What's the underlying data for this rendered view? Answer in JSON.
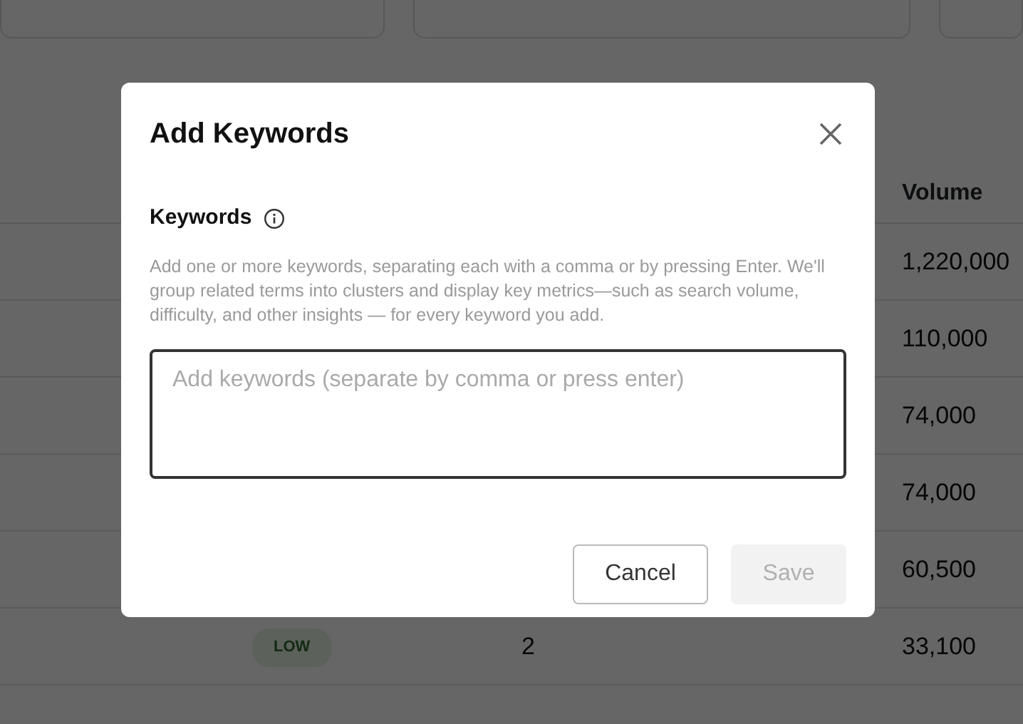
{
  "table": {
    "columns": [
      "Volume"
    ],
    "rows": [
      {
        "volume": "1,220,000"
      },
      {
        "volume": "110,000"
      },
      {
        "volume": "74,000"
      },
      {
        "volume": "74,000"
      },
      {
        "volume": "60,500"
      },
      {
        "tag": "LOW",
        "column_3": "2",
        "volume": "33,100"
      }
    ]
  },
  "dialog": {
    "title": "Add Keywords",
    "field_label": "Keywords",
    "help_text": "Add one or more keywords, separating each with a comma or by pressing Enter. We'll group related terms into clusters and display key metrics—such as search volume, difficulty, and other insights — for every keyword you add.",
    "input": {
      "placeholder": "Add keywords (separate by comma or press enter)"
    },
    "buttons": [
      {
        "label": "Cancel",
        "kind": "secondary",
        "disabled": false
      },
      {
        "label": "Save",
        "kind": "primary",
        "disabled": true
      }
    ]
  }
}
